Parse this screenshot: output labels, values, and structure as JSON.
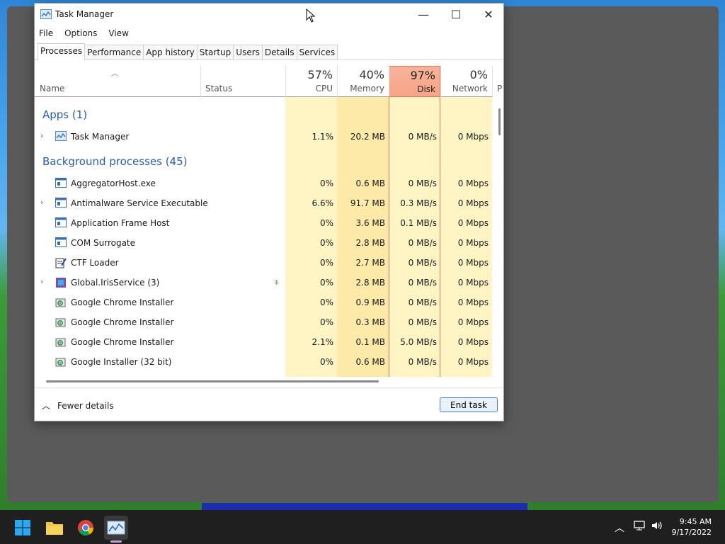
{
  "window": {
    "title": "Task Manager",
    "minimize": "—",
    "maximize": "☐",
    "close": "✕"
  },
  "menu": [
    "File",
    "Options",
    "View"
  ],
  "tabs": [
    "Processes",
    "Performance",
    "App history",
    "Startup",
    "Users",
    "Details",
    "Services"
  ],
  "header": {
    "name": "Name",
    "status": "Status",
    "cpu_pct": "57%",
    "cpu": "CPU",
    "mem_pct": "40%",
    "mem": "Memory",
    "disk_pct": "97%",
    "disk": "Disk",
    "net_pct": "0%",
    "net": "Network",
    "power": "Po"
  },
  "groups": {
    "apps": "Apps (1)",
    "background": "Background processes (45)"
  },
  "rows": [
    {
      "name": "Task Manager",
      "cpu": "1.1%",
      "mem": "20.2 MB",
      "disk": "0 MB/s",
      "net": "0 Mbps"
    },
    {
      "name": "AggregatorHost.exe",
      "cpu": "0%",
      "mem": "0.6 MB",
      "disk": "0 MB/s",
      "net": "0 Mbps"
    },
    {
      "name": "Antimalware Service Executable",
      "cpu": "6.6%",
      "mem": "91.7 MB",
      "disk": "0.3 MB/s",
      "net": "0 Mbps"
    },
    {
      "name": "Application Frame Host",
      "cpu": "0%",
      "mem": "3.6 MB",
      "disk": "0.1 MB/s",
      "net": "0 Mbps"
    },
    {
      "name": "COM Surrogate",
      "cpu": "0%",
      "mem": "2.8 MB",
      "disk": "0 MB/s",
      "net": "0 Mbps"
    },
    {
      "name": "CTF Loader",
      "cpu": "0%",
      "mem": "2.7 MB",
      "disk": "0 MB/s",
      "net": "0 Mbps"
    },
    {
      "name": "Global.IrisService (3)",
      "cpu": "0%",
      "mem": "2.8 MB",
      "disk": "0 MB/s",
      "net": "0 Mbps"
    },
    {
      "name": "Google Chrome Installer",
      "cpu": "0%",
      "mem": "0.9 MB",
      "disk": "0 MB/s",
      "net": "0 Mbps"
    },
    {
      "name": "Google Chrome Installer",
      "cpu": "0%",
      "mem": "0.3 MB",
      "disk": "0 MB/s",
      "net": "0 Mbps"
    },
    {
      "name": "Google Chrome Installer",
      "cpu": "2.1%",
      "mem": "0.1 MB",
      "disk": "5.0 MB/s",
      "net": "0 Mbps"
    },
    {
      "name": "Google Installer (32 bit)",
      "cpu": "0%",
      "mem": "0.6 MB",
      "disk": "0 MB/s",
      "net": "0 Mbps"
    }
  ],
  "footer": {
    "fewer_details": "Fewer details",
    "end_task": "End task"
  },
  "taskbar": {
    "time": "9:45 AM",
    "date": "9/17/2022"
  },
  "colors": {
    "cpu_band": "#fff4c4",
    "mem_band": "#fde9a8",
    "disk_header": "#f6a487",
    "group_text": "#2a5fa8"
  }
}
